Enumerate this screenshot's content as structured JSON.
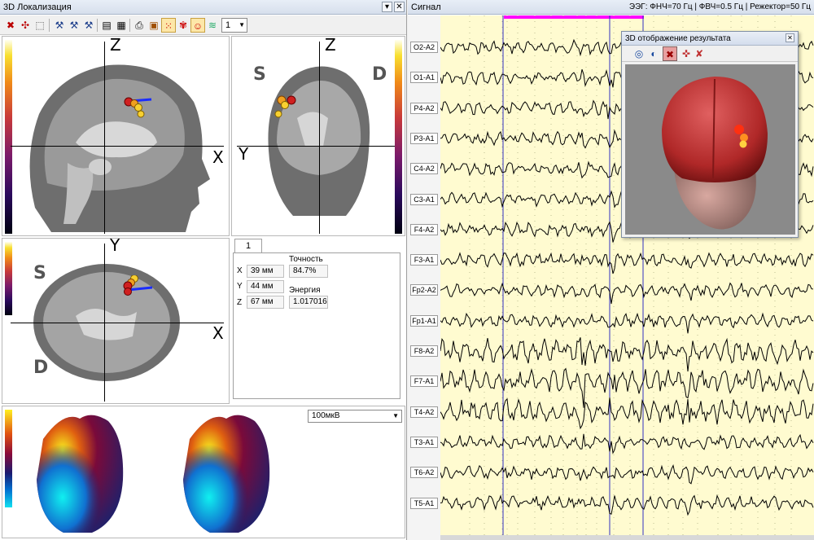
{
  "left_pane": {
    "title": "3D Локализация",
    "toolbar": {
      "channel_select": "1"
    },
    "icons": [
      "delete-icon",
      "delete-all-icon",
      "crop-icon",
      "hammer-icon",
      "hammer2-icon",
      "hammer3-icon",
      "table-icon",
      "grid-icon",
      "print-icon",
      "save-icon",
      "dots-icon",
      "brain-icon",
      "head-icon",
      "layers-icon"
    ],
    "sagittal": {
      "axis_vertical": "Z",
      "axis_horizontal": "X"
    },
    "coronal": {
      "axis_vertical": "Z",
      "axis_horizontal": "Y",
      "side_left": "S",
      "side_right": "D"
    },
    "axial": {
      "axis_vertical": "Y",
      "axis_horizontal": "X",
      "side_top": "S",
      "side_bottom": "D"
    },
    "result": {
      "tab": "1",
      "x_label": "X",
      "x_value": "39 мм",
      "y_label": "Y",
      "y_value": "44 мм",
      "z_label": "Z",
      "z_value": "67 мм",
      "accuracy_label": "Точность",
      "accuracy_value": "84.7%",
      "energy_label": "Энергия",
      "energy_value": "1.017016"
    },
    "amplitude_select": "100мкВ"
  },
  "signal_pane": {
    "title": "Сигнал",
    "filters": "ЭЭГ: ФНЧ=70 Гц | ФВЧ=0.5 Гц | Режектор=50 Гц",
    "channels": [
      "O2-A2",
      "O1-A1",
      "P4-A2",
      "P3-A1",
      "C4-A2",
      "C3-A1",
      "F4-A2",
      "F3-A1",
      "Fp2-A2",
      "Fp1-A1",
      "F8-A2",
      "F7-A1",
      "T4-A2",
      "T3-A1",
      "T6-A2",
      "T5-A1"
    ]
  },
  "popup": {
    "title": "3D отображение  результата",
    "icons": [
      "rotate-icon",
      "reset-icon",
      "cross-icon",
      "marker-icon",
      "remove-icon"
    ]
  },
  "colors": {
    "eeg_bg": "#fffbd0",
    "marker": "#ff00ff",
    "cursor": "#3030c0",
    "trace": "#000000"
  }
}
